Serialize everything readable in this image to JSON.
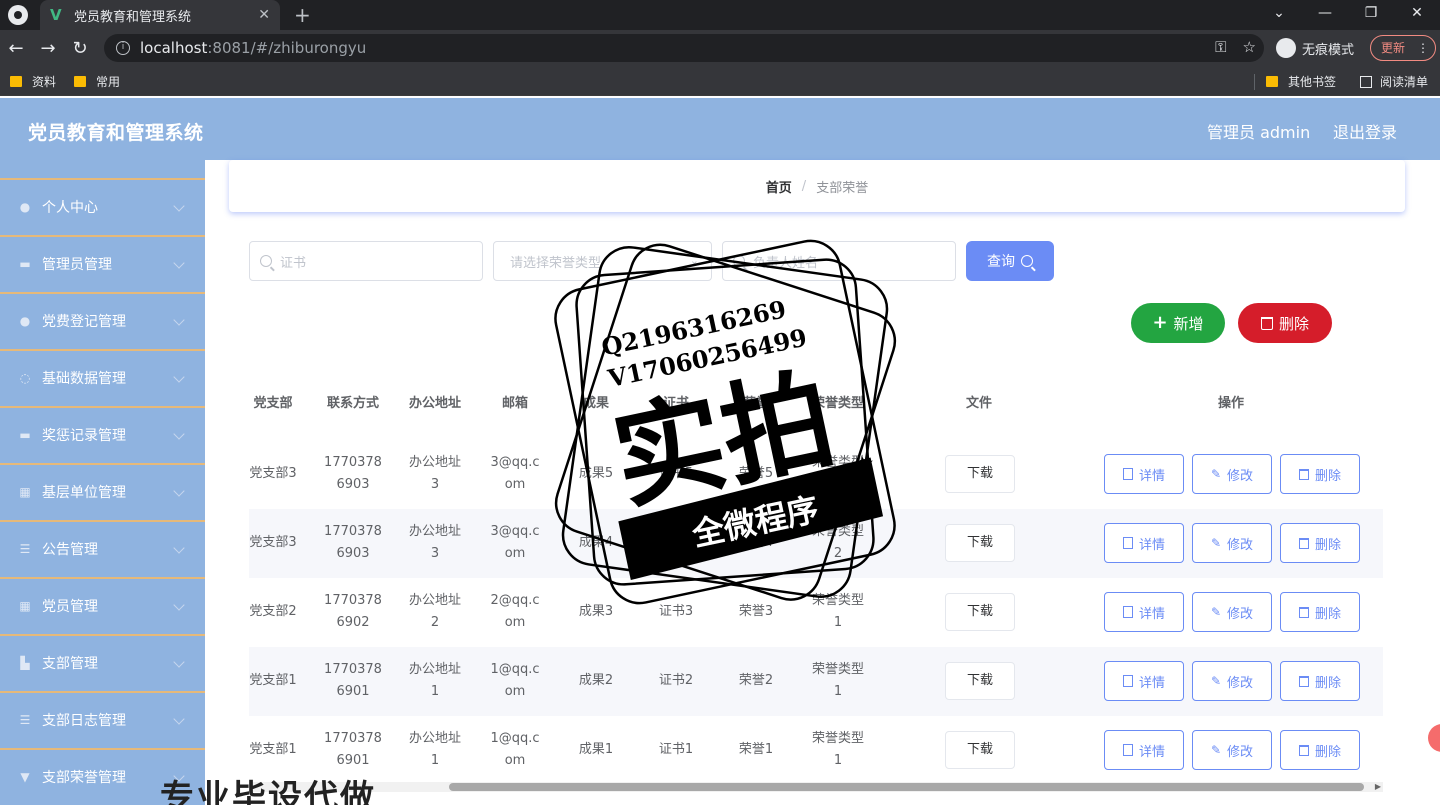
{
  "browser": {
    "tab_title": "党员教育和管理系统",
    "url_host": "localhost",
    "url_rest": ":8081/#/zhiburongyu",
    "incognito_label": "无痕模式",
    "update_label": "更新",
    "bookmarks": [
      "资料",
      "常用"
    ],
    "bookmarks_right": [
      "其他书签",
      "阅读清单"
    ]
  },
  "header": {
    "title": "党员教育和管理系统",
    "user": "管理员 admin",
    "logout": "退出登录"
  },
  "sidebar": {
    "items": [
      {
        "label": "个人中心",
        "icon": "user-icon"
      },
      {
        "label": "管理员管理",
        "icon": "chat-icon"
      },
      {
        "label": "党费登记管理",
        "icon": "user-icon"
      },
      {
        "label": "基础数据管理",
        "icon": "refresh-icon"
      },
      {
        "label": "奖惩记录管理",
        "icon": "chat-icon"
      },
      {
        "label": "基层单位管理",
        "icon": "grid-icon"
      },
      {
        "label": "公告管理",
        "icon": "list-icon"
      },
      {
        "label": "党员管理",
        "icon": "grid-icon"
      },
      {
        "label": "支部管理",
        "icon": "chart-icon"
      },
      {
        "label": "支部日志管理",
        "icon": "list-icon"
      },
      {
        "label": "支部荣誉管理",
        "icon": "trophy-icon"
      }
    ]
  },
  "breadcrumb": {
    "home": "首页",
    "current": "支部荣誉"
  },
  "search": {
    "cert_placeholder": "证书",
    "type_placeholder": "请选择荣誉类型",
    "person_placeholder": "负责人姓名",
    "query_label": "查询"
  },
  "actions": {
    "add_label": "新增",
    "delete_label": "删除"
  },
  "table": {
    "headers": [
      "党支部",
      "联系方式",
      "办公地址",
      "邮箱",
      "成果",
      "证书",
      "荣誉",
      "荣誉类型",
      "文件",
      "操作"
    ],
    "download_label": "下载",
    "op_labels": {
      "detail": "详情",
      "edit": "修改",
      "delete": "删除"
    },
    "rows": [
      {
        "branch": "党支部3",
        "phone1": "1770378",
        "phone2": "6903",
        "addr1": "办公地址",
        "addr2": "3",
        "mail1": "3@qq.c",
        "mail2": "om",
        "result": "成果5",
        "cert": "证书5",
        "honor": "荣誉5",
        "type1": "荣誉类型",
        "type2": "1"
      },
      {
        "branch": "党支部3",
        "phone1": "1770378",
        "phone2": "6903",
        "addr1": "办公地址",
        "addr2": "3",
        "mail1": "3@qq.c",
        "mail2": "om",
        "result": "成果4",
        "cert": "证书4",
        "honor": "荣誉4",
        "type1": "荣誉类型",
        "type2": "2"
      },
      {
        "branch": "党支部2",
        "phone1": "1770378",
        "phone2": "6902",
        "addr1": "办公地址",
        "addr2": "2",
        "mail1": "2@qq.c",
        "mail2": "om",
        "result": "成果3",
        "cert": "证书3",
        "honor": "荣誉3",
        "type1": "荣誉类型",
        "type2": "1"
      },
      {
        "branch": "党支部1",
        "phone1": "1770378",
        "phone2": "6901",
        "addr1": "办公地址",
        "addr2": "1",
        "mail1": "1@qq.c",
        "mail2": "om",
        "result": "成果2",
        "cert": "证书2",
        "honor": "荣誉2",
        "type1": "荣誉类型",
        "type2": "1"
      },
      {
        "branch": "党支部1",
        "phone1": "1770378",
        "phone2": "6901",
        "addr1": "办公地址",
        "addr2": "1",
        "mail1": "1@qq.c",
        "mail2": "om",
        "result": "成果1",
        "cert": "证书1",
        "honor": "荣誉1",
        "type1": "荣誉类型",
        "type2": "1"
      }
    ]
  },
  "watermark": {
    "line1": "Q2196316269",
    "line2": "V17060256499",
    "big": "实拍",
    "ribbon": "全微程序",
    "bottom": "专业毕设代做"
  },
  "colors": {
    "header_bg": "#8fb3e0",
    "primary": "#6b8cf5",
    "add_green": "#23a541",
    "delete_red": "#d51d2a"
  }
}
